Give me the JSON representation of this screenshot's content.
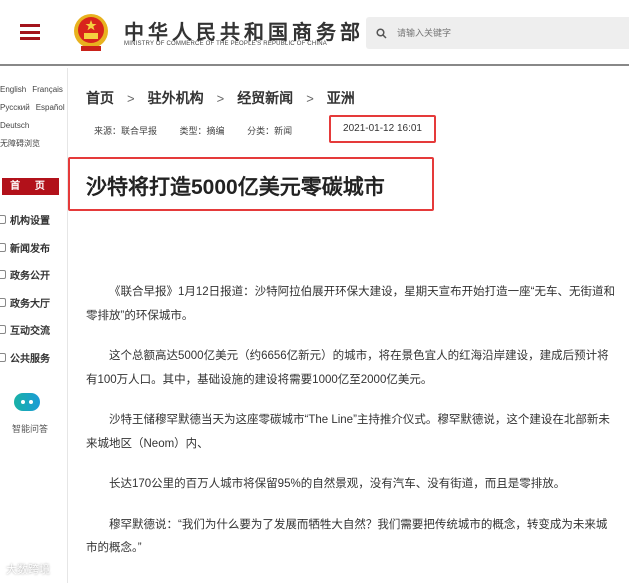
{
  "header": {
    "logo_cn": "中华人民共和国商务部",
    "logo_en": "MINISTRY OF COMMERCE OF THE PEOPLE'S REPUBLIC OF CHINA",
    "search_placeholder": "请输入关键字"
  },
  "sidebar": {
    "languages": [
      "English",
      "Français",
      "Русский",
      "Español",
      "Deutsch",
      "无障碍浏览"
    ],
    "home": "首 页",
    "items": [
      {
        "label": "机构设置"
      },
      {
        "label": "新闻发布"
      },
      {
        "label": "政务公开"
      },
      {
        "label": "政务大厅"
      },
      {
        "label": "互动交流"
      },
      {
        "label": "公共服务"
      }
    ],
    "assistant": "智能问答"
  },
  "breadcrumb": [
    "首页",
    "驻外机构",
    "经贸新闻",
    "亚洲"
  ],
  "meta": {
    "source": "来源：联合早报",
    "type": "类型：摘编",
    "category": "分类：新闻",
    "datetime": "2021-01-12 16:01"
  },
  "article": {
    "title": "沙特将打造5000亿美元零碳城市",
    "paragraphs": [
      "《联合早报》1月12日报道：沙特阿拉伯展开环保大建设，星期天宣布开始打造一座“无车、无街道和零排放”的环保城市。",
      "这个总额高达5000亿美元（约6656亿新元）的城市，将在景色宜人的红海沿岸建设，建成后预计将有100万人口。其中，基础设施的建设将需要1000亿至2000亿美元。",
      "沙特王储穆罕默德当天为这座零碳城市“The Line”主持推介仪式。穆罕默德说，这个建设在北部新未来城地区（Neom）内、",
      "长达170公里的百万人城市将保留95%的自然景观，没有汽车、没有街道，而且是零排放。",
      "穆罕默德说：“我们为什么要为了发展而牺牲大自然？我们需要把传统城市的概念，转变成为未来城市的概念。”"
    ]
  },
  "watermark": "大数跨境",
  "colors": {
    "accent": "#b2111a",
    "highlight": "#e53a3a"
  }
}
